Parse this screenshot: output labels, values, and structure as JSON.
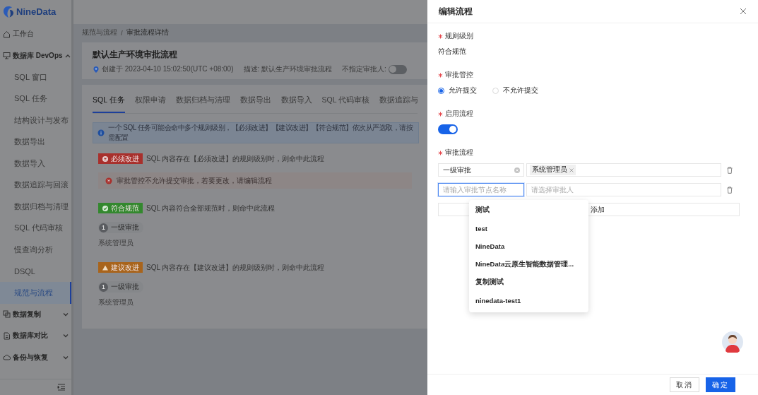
{
  "logo": {
    "text": "NineData"
  },
  "sidebar": {
    "items": [
      {
        "kind": "link",
        "label": "工作台",
        "selected": false
      },
      {
        "kind": "group",
        "label": "数据库 DevOps",
        "selected": false,
        "expanded": true,
        "children": [
          {
            "label": "SQL 窗口",
            "selected": false
          },
          {
            "label": "SQL 任务",
            "selected": false
          },
          {
            "label": "结构设计与发布",
            "selected": false
          },
          {
            "label": "数据导出",
            "selected": false
          },
          {
            "label": "数据导入",
            "selected": false
          },
          {
            "label": "数据追踪与回滚",
            "selected": false
          },
          {
            "label": "数据归档与清理",
            "selected": false
          },
          {
            "label": "SQL 代码审核",
            "selected": false
          },
          {
            "label": "慢查询分析",
            "selected": false
          },
          {
            "label": "DSQL",
            "selected": false
          },
          {
            "label": "规范与流程",
            "selected": true
          }
        ]
      },
      {
        "kind": "group",
        "label": "数据复制",
        "selected": false,
        "expanded": false
      },
      {
        "kind": "group",
        "label": "数据库对比",
        "selected": false,
        "expanded": false
      },
      {
        "kind": "group",
        "label": "备份与恢复",
        "selected": false,
        "expanded": false
      }
    ]
  },
  "breadcrumb": {
    "items": [
      "规范与流程",
      "审批流程详情"
    ],
    "separator": "/"
  },
  "flow": {
    "title": "默认生产环境审批流程",
    "created": "创建于 2023-04-10 15:02:50(UTC +08:00)",
    "description": "描述: 默认生产环境审批流程",
    "no_approver_label": "不指定审批人:",
    "no_approver_on": false
  },
  "tabs": [
    {
      "label": "SQL 任务",
      "selected": true
    },
    {
      "label": "权限申请",
      "selected": false
    },
    {
      "label": "数据归档与清理",
      "selected": false
    },
    {
      "label": "数据导出",
      "selected": false
    },
    {
      "label": "数据导入",
      "selected": false
    },
    {
      "label": "SQL 代码审核",
      "selected": false
    },
    {
      "label": "数据追踪与",
      "selected": false
    }
  ],
  "info": "一个 SQL 任务可能会命中多个规则级别，【必须改进】【建议改进】【符合规范】依次从严选取，请按需配置",
  "rules": [
    {
      "kind": "must",
      "tag": "必须改进",
      "color": "#a8302c",
      "text": "SQL 内容存在【必须改进】的规则级别时，则命中此流程",
      "alert": "审批管控不允许提交审批，若要更改，请编辑流程"
    },
    {
      "kind": "pass",
      "tag": "符合规范",
      "color": "#33882e",
      "text": "SQL 内容符合全部规范时，则命中此流程",
      "steps": [
        {
          "number": "1",
          "name": "一级审批",
          "approver": "系统管理员"
        }
      ]
    },
    {
      "kind": "suggest",
      "tag": "建议改进",
      "color": "#a8641c",
      "text": "SQL 内容存在【建议改进】的规则级别时，则命中此流程",
      "steps": [
        {
          "number": "1",
          "name": "一级审批",
          "approver": "系统管理员"
        }
      ]
    }
  ],
  "drawer": {
    "title": "编辑流程",
    "fields": [
      {
        "kind": "text",
        "label": "规则级别",
        "required": true,
        "value": "符合规范"
      },
      {
        "kind": "radio",
        "label": "审批管控",
        "required": true,
        "options": [
          {
            "label": "允许提交",
            "selected": true
          },
          {
            "label": "不允许提交",
            "selected": false
          }
        ]
      },
      {
        "kind": "switch",
        "label": "启用流程",
        "required": true,
        "on": true
      },
      {
        "kind": "nodes",
        "label": "审批流程",
        "required": true,
        "add_label": "添加",
        "nodes": [
          {
            "name": "一级审批",
            "approvers": [
              "系统管理员"
            ],
            "focused": false
          },
          {
            "name_placeholder": "请输入审批节点名称",
            "approver_placeholder": "请选择审批人",
            "focused": true
          }
        ]
      }
    ],
    "menu": [
      "测试",
      "test",
      "NineData",
      "NineData云原生智能数据管理...",
      "复制测试",
      "ninedata-test1"
    ],
    "buttons": [
      {
        "kind": "default",
        "label": "取消"
      },
      {
        "kind": "primary",
        "label": "确定"
      }
    ]
  }
}
